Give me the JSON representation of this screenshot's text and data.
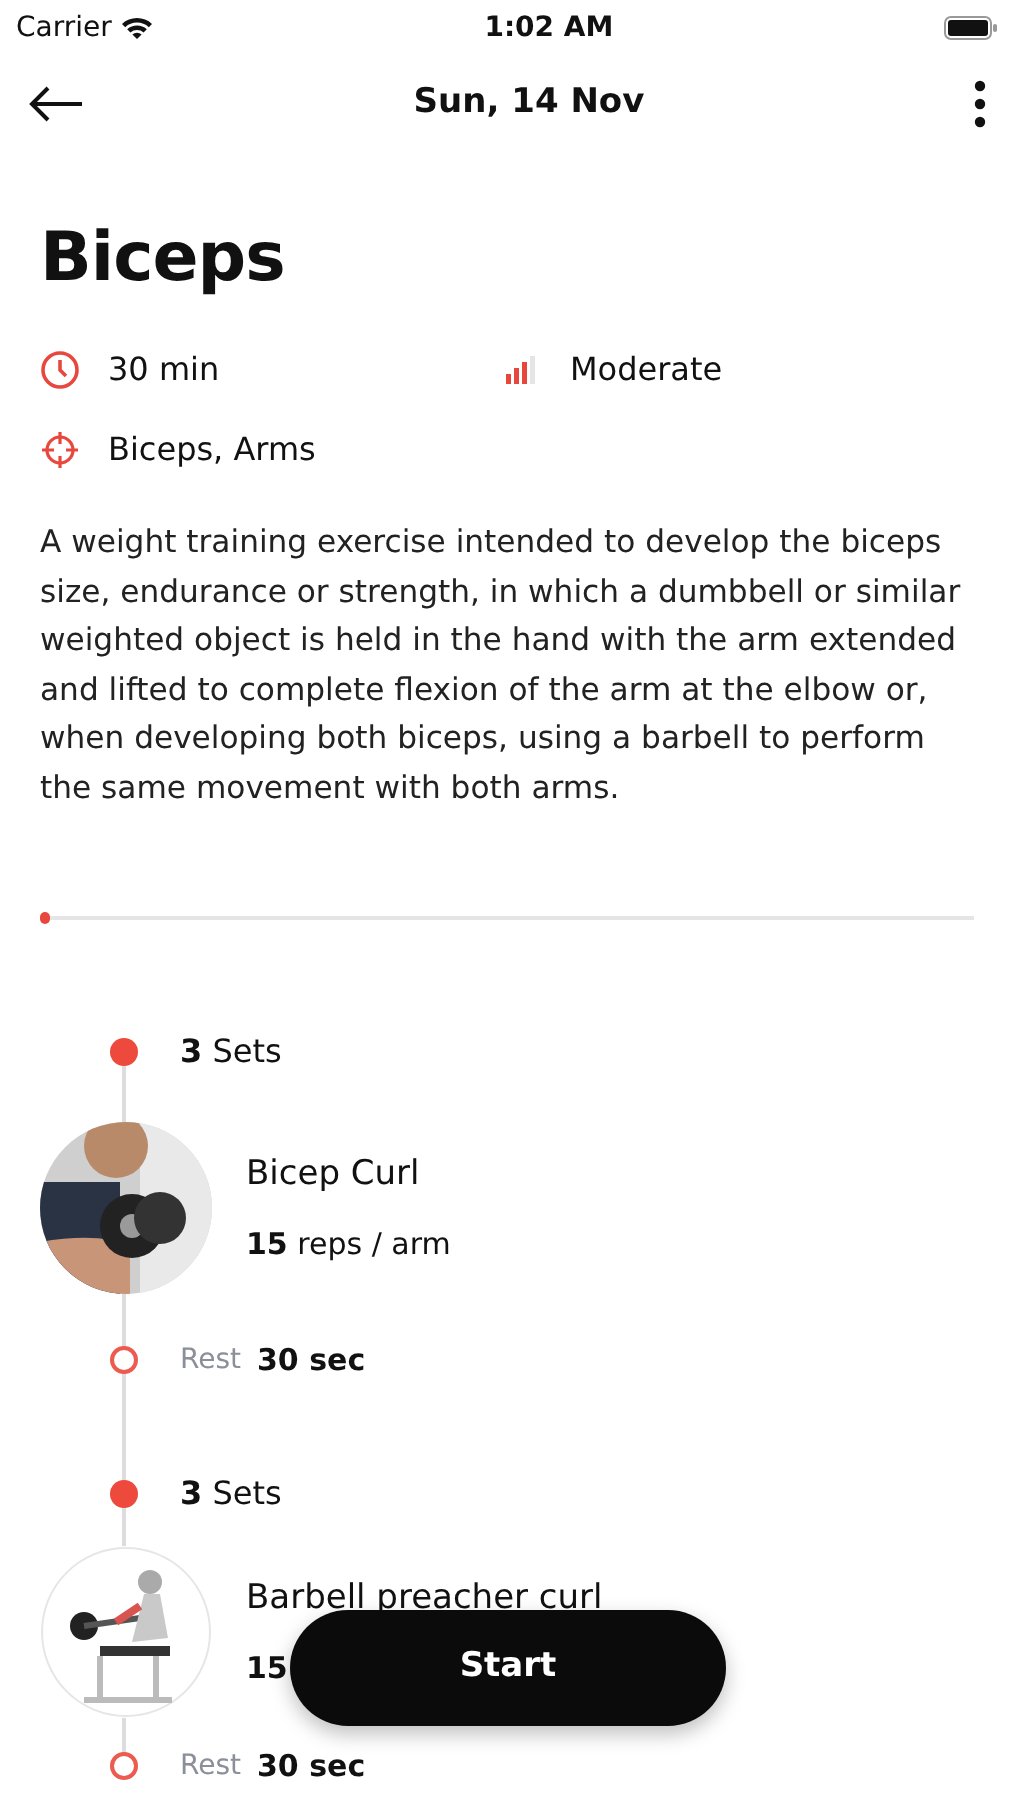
{
  "status_bar": {
    "carrier": "Carrier",
    "time": "1:02 AM"
  },
  "header": {
    "title": "Sun, 14 Nov"
  },
  "workout": {
    "title": "Biceps",
    "duration": "30 min",
    "difficulty": "Moderate",
    "muscles": "Biceps, Arms",
    "description": "A weight training exercise intended to develop the biceps size, endurance or strength, in which a dumbbell or similar weighted object is held in the hand with the arm extended and lifted to complete flexion of the arm at the elbow or, when developing both biceps, using a barbell to perform the same movement with both arms."
  },
  "progress": {
    "level": 0.01
  },
  "exercises": [
    {
      "sets": "**3** Sets",
      "name": "Bicep Curl",
      "reps": "**15** reps / arm",
      "rest_label": "Rest",
      "rest": "30 sec"
    },
    {
      "sets": "**3** Sets",
      "name": "Barbell preacher curl",
      "reps": "**15**",
      "rest_label": "Rest",
      "rest": "30 sec"
    }
  ],
  "start_button": {
    "label": "Start"
  }
}
